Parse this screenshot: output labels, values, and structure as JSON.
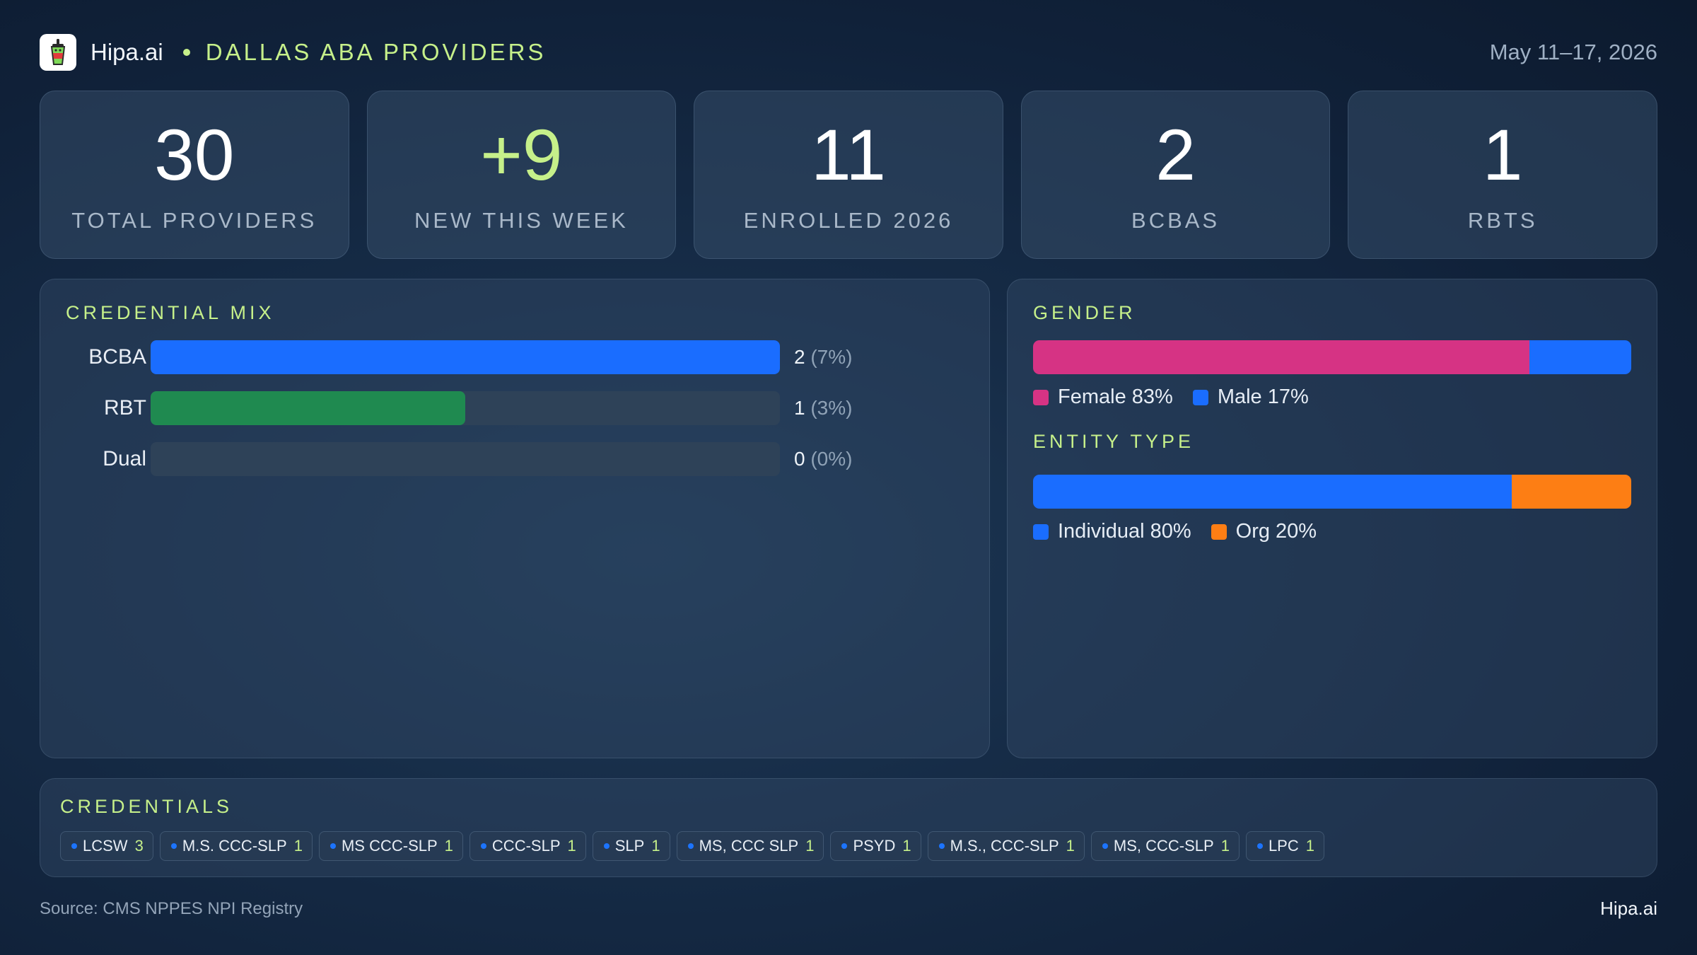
{
  "header": {
    "brand": "Hipa.ai",
    "region": "DALLAS ABA PROVIDERS",
    "date_range": "May 11–17, 2026",
    "logo_icon": "cup-logo-icon"
  },
  "kpis": [
    {
      "value": "30",
      "label": "TOTAL PROVIDERS"
    },
    {
      "value": "+9",
      "label": "NEW THIS WEEK"
    },
    {
      "value": "11",
      "label": "ENROLLED 2026"
    },
    {
      "value": "2",
      "label": "BCBAS"
    },
    {
      "value": "1",
      "label": "RBTS"
    }
  ],
  "credential_mix": {
    "title": "CREDENTIAL MIX",
    "rows": [
      {
        "label": "BCBA",
        "count": "2",
        "pct": "(7%)",
        "fraction": 1.0,
        "color": "#1a6dff"
      },
      {
        "label": "RBT",
        "count": "1",
        "pct": "(3%)",
        "fraction": 0.5,
        "color": "#1f8a50"
      },
      {
        "label": "Dual",
        "count": "0",
        "pct": "(0%)",
        "fraction": 0.0,
        "color": "#1a6dff"
      }
    ]
  },
  "gender": {
    "title": "GENDER",
    "segments": [
      {
        "label": "Female 83%",
        "value": 83,
        "color": "#d63384"
      },
      {
        "label": "Male 17%",
        "value": 17,
        "color": "#1a6dff"
      }
    ]
  },
  "entity_type": {
    "title": "ENTITY TYPE",
    "segments": [
      {
        "label": "Individual 80%",
        "value": 80,
        "color": "#1a6dff"
      },
      {
        "label": "Org 20%",
        "value": 20,
        "color": "#fd7e14"
      }
    ]
  },
  "credentials": {
    "title": "CREDENTIALS",
    "chips": [
      {
        "label": "LCSW",
        "count": "3"
      },
      {
        "label": "M.S. CCC-SLP",
        "count": "1"
      },
      {
        "label": "MS CCC-SLP",
        "count": "1"
      },
      {
        "label": "CCC-SLP",
        "count": "1"
      },
      {
        "label": "SLP",
        "count": "1"
      },
      {
        "label": "MS, CCC SLP",
        "count": "1"
      },
      {
        "label": "PSYD",
        "count": "1"
      },
      {
        "label": "M.S., CCC-SLP",
        "count": "1"
      },
      {
        "label": "MS, CCC-SLP",
        "count": "1"
      },
      {
        "label": "LPC",
        "count": "1"
      }
    ]
  },
  "footer": {
    "source": "Source: CMS NPPES NPI Registry",
    "brand": "Hipa.ai"
  }
}
